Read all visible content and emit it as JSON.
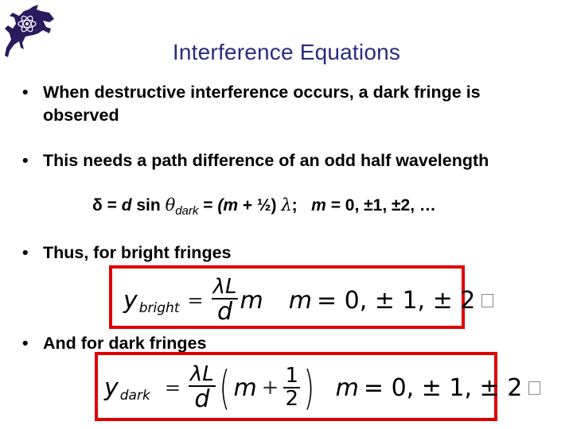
{
  "logo": {
    "icon": "horned-frog-atom-logo",
    "color": "#2a1a5e"
  },
  "title": "Interference Equations",
  "bullets": [
    {
      "marker": "•",
      "text": "When destructive interference occurs, a dark fringe is observed"
    },
    {
      "marker": "•",
      "text": "This needs a path difference of an odd half wavelength"
    },
    {
      "marker": "•",
      "text": "Thus, for bright fringes"
    },
    {
      "marker": "•",
      "text": "And for dark fringes"
    }
  ],
  "path_difference_equation": {
    "delta": "δ",
    "eq1": "=",
    "d": "d",
    "sin": "sin",
    "theta": "θ",
    "theta_sub": "dark",
    "eq2": "=",
    "open": "(",
    "m": "m",
    "plus_half": "+ ½)",
    "lambda": "λ",
    "semicolon": ";",
    "m2": "m",
    "values": "= 0, ±1, ±2, …"
  },
  "bright_equation": {
    "y": "y",
    "sub": "bright",
    "equals": "=",
    "numerator": "λL",
    "denominator": "d",
    "m": "m",
    "m_label": "m",
    "values": "= 0, ± 1, ± 2"
  },
  "dark_equation": {
    "y": "y",
    "sub": "dark",
    "equals": "=",
    "numerator": "λL",
    "denominator": "d",
    "lparen": "(",
    "m": "m",
    "plus": "+",
    "half_num": "1",
    "half_den": "2",
    "rparen": ")",
    "m_label": "m",
    "values": "= 0, ± 1, ± 2"
  },
  "colors": {
    "title": "#2b2b7f",
    "box_border": "#e00000",
    "text": "#000000"
  }
}
